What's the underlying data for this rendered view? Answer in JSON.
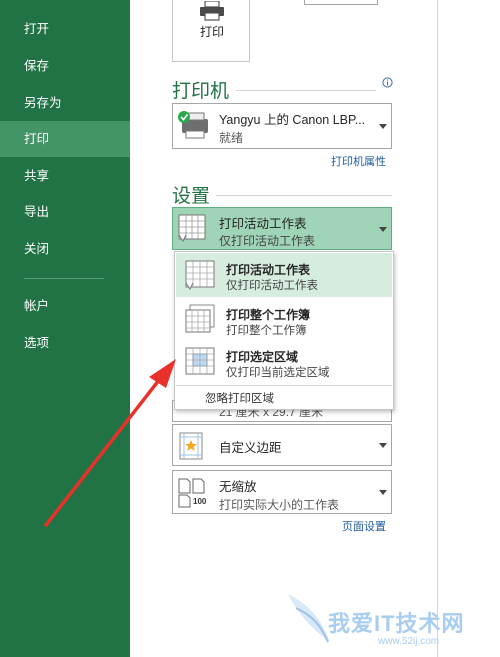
{
  "sidebar": {
    "items": [
      {
        "label": "打开"
      },
      {
        "label": "保存"
      },
      {
        "label": "另存为"
      },
      {
        "label": "打印"
      },
      {
        "label": "共享"
      },
      {
        "label": "导出"
      },
      {
        "label": "关闭"
      }
    ],
    "bottom_items": [
      {
        "label": "帐户"
      },
      {
        "label": "选项"
      }
    ]
  },
  "print_button": {
    "label": "打印"
  },
  "printer": {
    "section_title": "打印机",
    "name": "Yangyu 上的 Canon LBP...",
    "status": "就绪",
    "properties_link": "打印机属性"
  },
  "settings": {
    "section_title": "设置",
    "scope_dropdown": {
      "title": "打印活动工作表",
      "subtitle": "仅打印活动工作表"
    },
    "popup_options": [
      {
        "title": "打印活动工作表",
        "subtitle": "仅打印活动工作表"
      },
      {
        "title": "打印整个工作簿",
        "subtitle": "打印整个工作簿"
      },
      {
        "title": "打印选定区域",
        "subtitle": "仅打印当前选定区域"
      }
    ],
    "popup_ignore": "忽略打印区域",
    "paper_partial": "21 厘米 x 29.7 厘米",
    "margins": {
      "title": "自定义边距"
    },
    "scaling": {
      "title": "无缩放",
      "subtitle": "打印实际大小的工作表",
      "icon_text": "100"
    },
    "page_setup_link": "页面设置"
  },
  "watermark": {
    "text": "我爱IT技术网",
    "url": "www.52ij.com"
  },
  "colors": {
    "brand": "#217346",
    "active_nav": "#439467",
    "annotation": "#e8312a"
  }
}
